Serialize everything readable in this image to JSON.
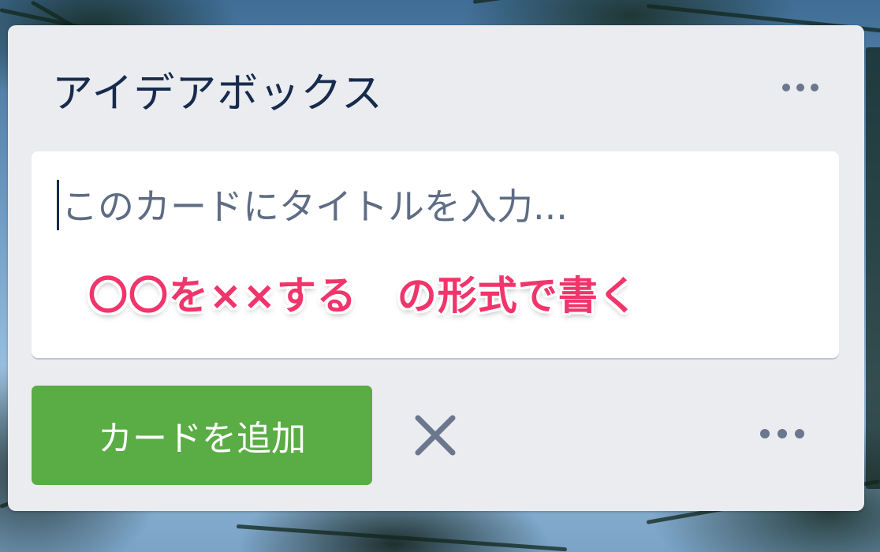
{
  "list": {
    "title": "アイデアボックス"
  },
  "composer": {
    "placeholder": "このカードにタイトルを入力...",
    "value": ""
  },
  "annotation": {
    "text": "〇〇を××する　の形式で書く",
    "color": "#f0356b"
  },
  "actions": {
    "add_card_label": "カードを追加",
    "close_icon": "close-icon",
    "more_icon": "more-options-icon"
  },
  "colors": {
    "list_background": "#ebecf0",
    "button_green": "#5aac44",
    "title_text": "#172b4d",
    "icon_gray": "#6b778c"
  }
}
